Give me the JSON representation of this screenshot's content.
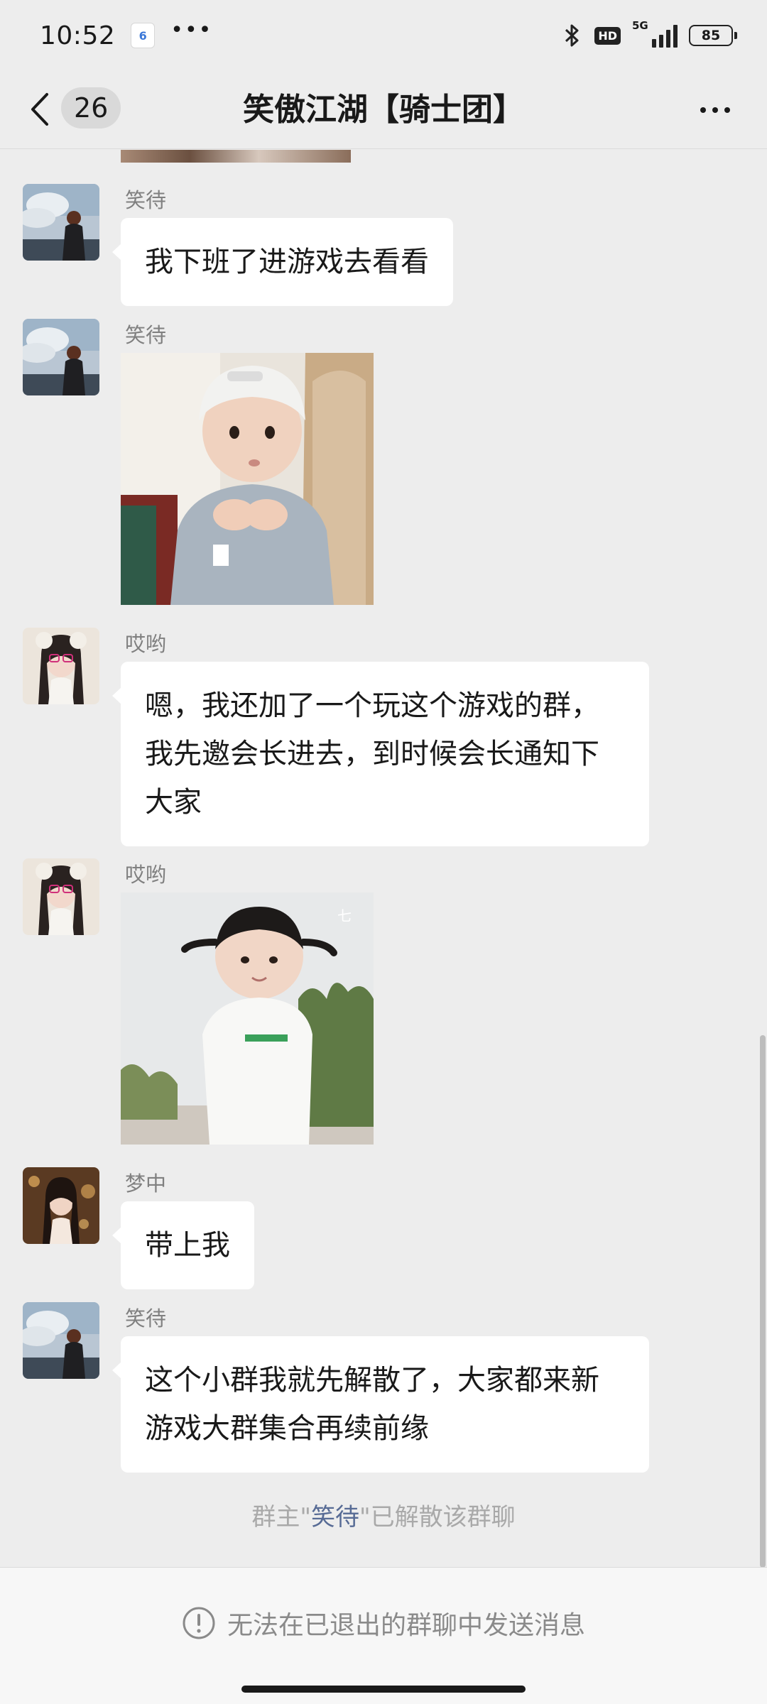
{
  "status_bar": {
    "time": "10:52",
    "app_badge": "6",
    "more_indicator": "•••",
    "hd": "HD",
    "network": "5G",
    "battery": "85"
  },
  "nav": {
    "unread_count": "26",
    "title": "笑傲江湖【骑士团】"
  },
  "messages": [
    {
      "sender": "笑待",
      "type": "text",
      "text": "我下班了进游戏去看看"
    },
    {
      "sender": "笑待",
      "type": "image",
      "image": "sticker-baby-beanie"
    },
    {
      "sender": "哎哟",
      "type": "text",
      "text": "嗯，我还加了一个玩这个游戏的群，我先邀会长进去，到时候会长通知下大家"
    },
    {
      "sender": "哎哟",
      "type": "image",
      "image": "sticker-baby-pigtails"
    },
    {
      "sender": "梦中",
      "type": "text",
      "text": "带上我"
    },
    {
      "sender": "笑待",
      "type": "text",
      "text": "这个小群我就先解散了，大家都来新游戏大群集合再续前缘"
    }
  ],
  "system_notice": {
    "prefix": "群主\"",
    "name": "笑待",
    "suffix": "\"已解散该群聊"
  },
  "footer": {
    "notice": "无法在已退出的群聊中发送消息",
    "icon": "exclamation-circle-icon"
  },
  "colors": {
    "background": "#ededed",
    "bubble": "#ffffff",
    "link": "#576b95",
    "sender_name": "#808080"
  }
}
